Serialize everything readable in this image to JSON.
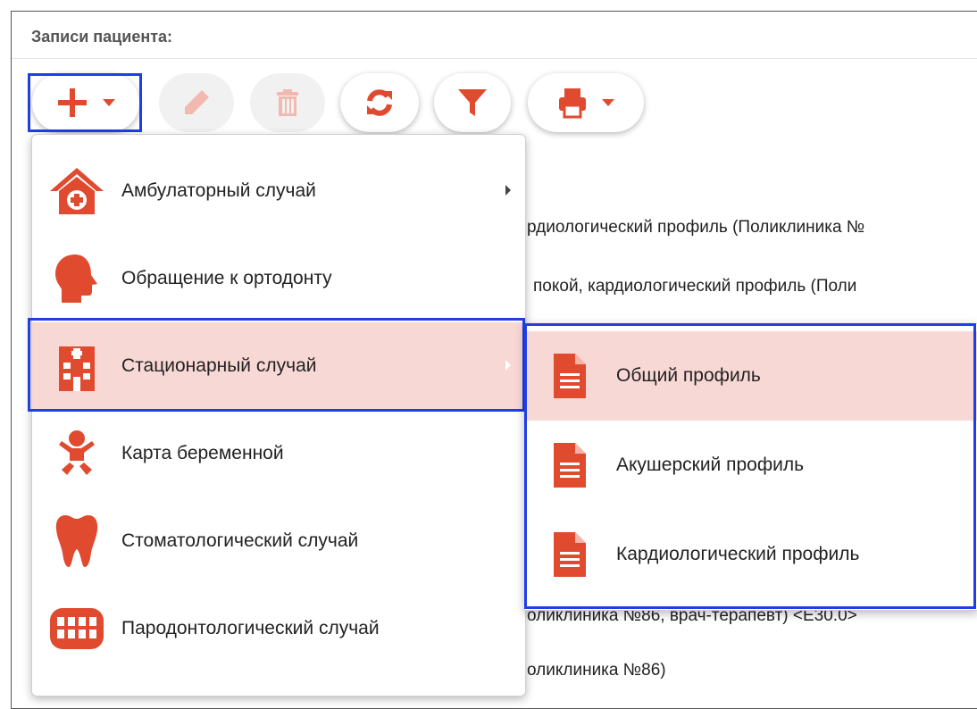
{
  "panel": {
    "title": "Записи пациента:"
  },
  "toolbar": {
    "buttons": [
      {
        "name": "add",
        "icon": "plus-icon",
        "dropdown": true,
        "enabled": true
      },
      {
        "name": "edit",
        "icon": "pencil-icon",
        "enabled": false
      },
      {
        "name": "delete",
        "icon": "trash-icon",
        "enabled": false
      },
      {
        "name": "refresh",
        "icon": "refresh-icon",
        "enabled": true
      },
      {
        "name": "filter",
        "icon": "filter-icon",
        "enabled": true
      },
      {
        "name": "print",
        "icon": "printer-icon",
        "dropdown": true,
        "enabled": true
      }
    ]
  },
  "background_rows": [
    "рдиологический профиль (Поликлиника №",
    "покой, кардиологический профиль (Поли",
    "оликлиника №86, врач-терапевт) <E30.0>",
    "оликлиника №86)"
  ],
  "menu": {
    "items": [
      {
        "label": "Амбулаторный случай",
        "icon": "home-plus-icon",
        "has_submenu": true,
        "active": false
      },
      {
        "label": "Обращение к ортодонту",
        "icon": "head-profile-icon",
        "has_submenu": false,
        "active": false
      },
      {
        "label": "Стационарный случай",
        "icon": "hospital-icon",
        "has_submenu": true,
        "active": true
      },
      {
        "label": "Карта беременной",
        "icon": "baby-icon",
        "has_submenu": false,
        "active": false
      },
      {
        "label": "Стоматологический случай",
        "icon": "tooth-icon",
        "has_submenu": false,
        "active": false
      },
      {
        "label": "Пародонтологический случай",
        "icon": "teeth-icon",
        "has_submenu": false,
        "active": false
      }
    ]
  },
  "submenu": {
    "items": [
      {
        "label": "Общий профиль",
        "icon": "document-icon",
        "active": true
      },
      {
        "label": "Акушерский профиль",
        "icon": "document-icon",
        "active": false
      },
      {
        "label": "Кардиологический профиль",
        "icon": "document-icon",
        "active": false
      }
    ]
  },
  "colors": {
    "accent": "#e04a2f",
    "highlight_border": "#1f3ee6",
    "active_bg": "#f8d8d5"
  }
}
